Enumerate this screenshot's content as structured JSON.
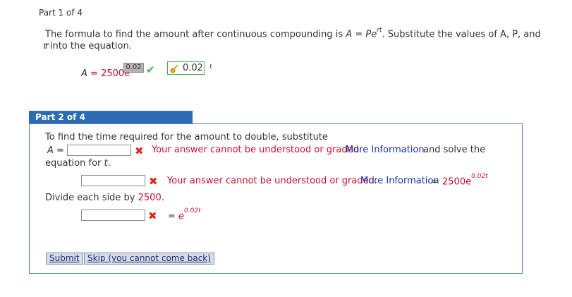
{
  "part1": {
    "label": "Part 1 of 4",
    "sentence_a": "The formula to find the amount after continuous compounding is ",
    "formula_lhs": "A",
    "formula_eq": " = ",
    "formula_base": "Pe",
    "formula_exp": "rt",
    "sentence_b": ". Substitute the values of A, P, and",
    "sentence_line2": "r into the equation.",
    "answer_lhs": "A",
    "answer_eq": " = ",
    "answer_base": "2500e",
    "exponent_value": "0.02",
    "correct_icon": "checkmark-icon",
    "hint_icon": "key-icon",
    "hint_value": "0.02",
    "hint_var": "t"
  },
  "part2": {
    "label": "Part 2 of 4",
    "instruction": "To find the time required for the amount to double, substitute",
    "line1_lhs": "A",
    "line1_eq": "=",
    "input1_value": "",
    "error_text": "Your answer cannot be understood or graded.",
    "more_info": "More Information",
    "line1_tail": "and solve the",
    "line1_tail2": "equation for t.",
    "input2_value": "",
    "line2_eq": " = ",
    "line2_base": "2500e",
    "line2_exp": "0.02t",
    "divide_text": "Divide each side by ",
    "divide_value": "2500",
    "divide_period": ".",
    "input3_value": "",
    "line3_eq": "= ",
    "line3_base": "e",
    "line3_exp": "0.02t",
    "error_icon": "x-icon"
  },
  "buttons": {
    "submit": "Submit",
    "skip": "Skip (you cannot come back)"
  },
  "colors": {
    "header_bg": "#2d6cb5",
    "error": "#c8102e",
    "link": "#1a34a6",
    "correct": "#4caf50"
  }
}
